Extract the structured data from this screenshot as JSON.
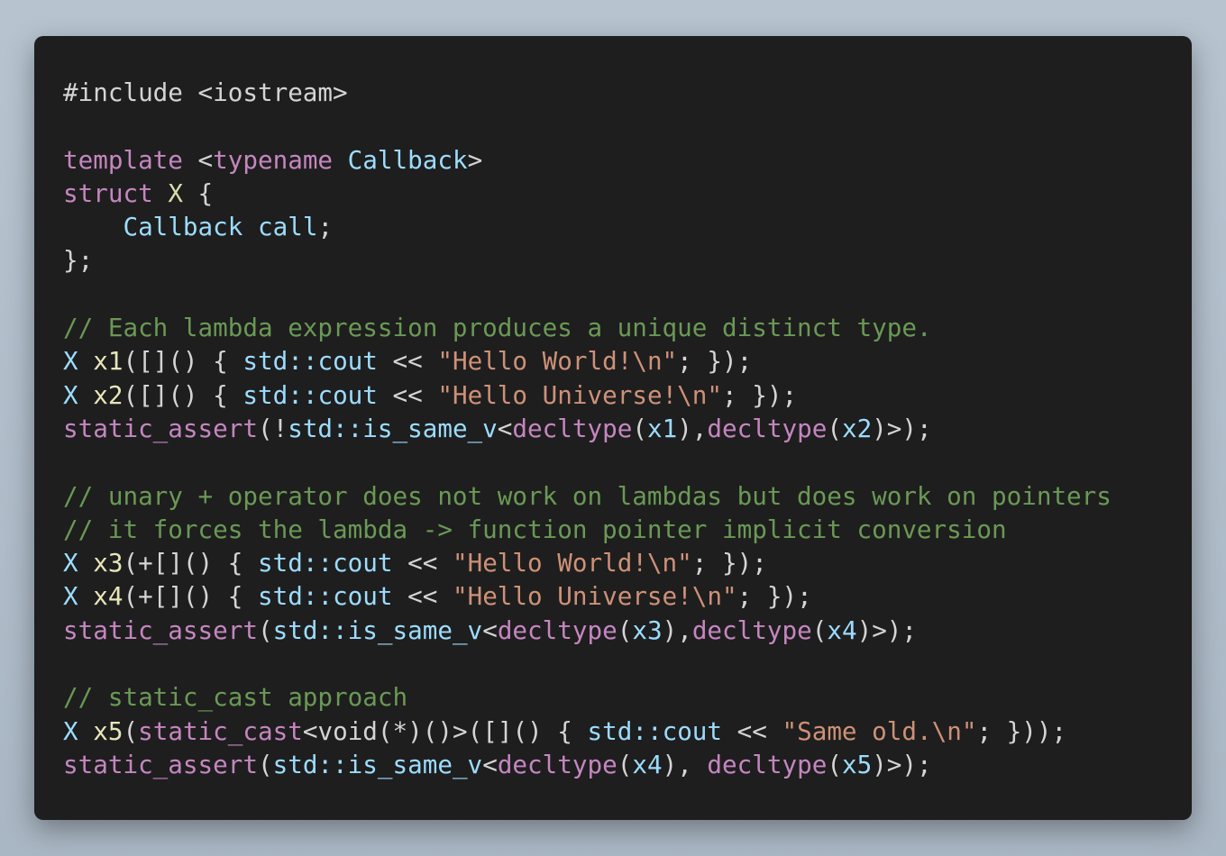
{
  "colors": {
    "background": "#1e1e1e",
    "default": "#d4d4d4",
    "keyword": "#c586c0",
    "type": "#9cdcfe",
    "classname": "#dcdcaa",
    "variable": "#e8e6b9",
    "string": "#ce9178",
    "comment": "#6a9955"
  },
  "code_lines": [
    [
      {
        "c": "plain",
        "t": "#include <iostream>"
      }
    ],
    [],
    [
      {
        "c": "kw",
        "t": "template"
      },
      {
        "c": "plain",
        "t": " <"
      },
      {
        "c": "kw",
        "t": "typename"
      },
      {
        "c": "plain",
        "t": " "
      },
      {
        "c": "type",
        "t": "Callback"
      },
      {
        "c": "plain",
        "t": ">"
      }
    ],
    [
      {
        "c": "kw",
        "t": "struct"
      },
      {
        "c": "plain",
        "t": " "
      },
      {
        "c": "class",
        "t": "X"
      },
      {
        "c": "plain",
        "t": " {"
      }
    ],
    [
      {
        "c": "plain",
        "t": "    "
      },
      {
        "c": "type",
        "t": "Callback"
      },
      {
        "c": "plain",
        "t": " "
      },
      {
        "c": "type",
        "t": "call"
      },
      {
        "c": "plain",
        "t": ";"
      }
    ],
    [
      {
        "c": "plain",
        "t": "};"
      }
    ],
    [],
    [
      {
        "c": "cmt",
        "t": "// Each lambda expression produces a unique distinct type."
      }
    ],
    [
      {
        "c": "type",
        "t": "X"
      },
      {
        "c": "plain",
        "t": " "
      },
      {
        "c": "var",
        "t": "x1"
      },
      {
        "c": "plain",
        "t": "([]() { "
      },
      {
        "c": "std",
        "t": "std::cout"
      },
      {
        "c": "plain",
        "t": " << "
      },
      {
        "c": "str",
        "t": "\"Hello World!\\n\""
      },
      {
        "c": "plain",
        "t": "; });"
      }
    ],
    [
      {
        "c": "type",
        "t": "X"
      },
      {
        "c": "plain",
        "t": " "
      },
      {
        "c": "var",
        "t": "x2"
      },
      {
        "c": "plain",
        "t": "([]() { "
      },
      {
        "c": "std",
        "t": "std::cout"
      },
      {
        "c": "plain",
        "t": " << "
      },
      {
        "c": "str",
        "t": "\"Hello Universe!\\n\""
      },
      {
        "c": "plain",
        "t": "; });"
      }
    ],
    [
      {
        "c": "kw",
        "t": "static_assert"
      },
      {
        "c": "plain",
        "t": "(!"
      },
      {
        "c": "std",
        "t": "std::is_same_v"
      },
      {
        "c": "plain",
        "t": "<"
      },
      {
        "c": "kw",
        "t": "decltype"
      },
      {
        "c": "plain",
        "t": "("
      },
      {
        "c": "std",
        "t": "x1"
      },
      {
        "c": "plain",
        "t": "),"
      },
      {
        "c": "kw",
        "t": "decltype"
      },
      {
        "c": "plain",
        "t": "("
      },
      {
        "c": "std",
        "t": "x2"
      },
      {
        "c": "plain",
        "t": ")>);"
      }
    ],
    [],
    [
      {
        "c": "cmt",
        "t": "// unary + operator does not work on lambdas but does work on pointers"
      }
    ],
    [
      {
        "c": "cmt",
        "t": "// it forces the lambda -> function pointer implicit conversion"
      }
    ],
    [
      {
        "c": "type",
        "t": "X"
      },
      {
        "c": "plain",
        "t": " "
      },
      {
        "c": "var",
        "t": "x3"
      },
      {
        "c": "plain",
        "t": "(+[]() { "
      },
      {
        "c": "std",
        "t": "std::cout"
      },
      {
        "c": "plain",
        "t": " << "
      },
      {
        "c": "str",
        "t": "\"Hello World!\\n\""
      },
      {
        "c": "plain",
        "t": "; });"
      }
    ],
    [
      {
        "c": "type",
        "t": "X"
      },
      {
        "c": "plain",
        "t": " "
      },
      {
        "c": "var",
        "t": "x4"
      },
      {
        "c": "plain",
        "t": "(+[]() { "
      },
      {
        "c": "std",
        "t": "std::cout"
      },
      {
        "c": "plain",
        "t": " << "
      },
      {
        "c": "str",
        "t": "\"Hello Universe!\\n\""
      },
      {
        "c": "plain",
        "t": "; });"
      }
    ],
    [
      {
        "c": "kw",
        "t": "static_assert"
      },
      {
        "c": "plain",
        "t": "("
      },
      {
        "c": "std",
        "t": "std::is_same_v"
      },
      {
        "c": "plain",
        "t": "<"
      },
      {
        "c": "kw",
        "t": "decltype"
      },
      {
        "c": "plain",
        "t": "("
      },
      {
        "c": "std",
        "t": "x3"
      },
      {
        "c": "plain",
        "t": "),"
      },
      {
        "c": "kw",
        "t": "decltype"
      },
      {
        "c": "plain",
        "t": "("
      },
      {
        "c": "std",
        "t": "x4"
      },
      {
        "c": "plain",
        "t": ")>);"
      }
    ],
    [],
    [
      {
        "c": "cmt",
        "t": "// static_cast approach"
      }
    ],
    [
      {
        "c": "type",
        "t": "X"
      },
      {
        "c": "plain",
        "t": " "
      },
      {
        "c": "var",
        "t": "x5"
      },
      {
        "c": "plain",
        "t": "("
      },
      {
        "c": "kw",
        "t": "static_cast"
      },
      {
        "c": "plain",
        "t": "<void(*)()>([]() { "
      },
      {
        "c": "std",
        "t": "std::cout"
      },
      {
        "c": "plain",
        "t": " << "
      },
      {
        "c": "str",
        "t": "\"Same old.\\n\""
      },
      {
        "c": "plain",
        "t": "; }));"
      }
    ],
    [
      {
        "c": "kw",
        "t": "static_assert"
      },
      {
        "c": "plain",
        "t": "("
      },
      {
        "c": "std",
        "t": "std::is_same_v"
      },
      {
        "c": "plain",
        "t": "<"
      },
      {
        "c": "kw",
        "t": "decltype"
      },
      {
        "c": "plain",
        "t": "("
      },
      {
        "c": "std",
        "t": "x4"
      },
      {
        "c": "plain",
        "t": "), "
      },
      {
        "c": "kw",
        "t": "decltype"
      },
      {
        "c": "plain",
        "t": "("
      },
      {
        "c": "std",
        "t": "x5"
      },
      {
        "c": "plain",
        "t": ")>);"
      }
    ]
  ]
}
